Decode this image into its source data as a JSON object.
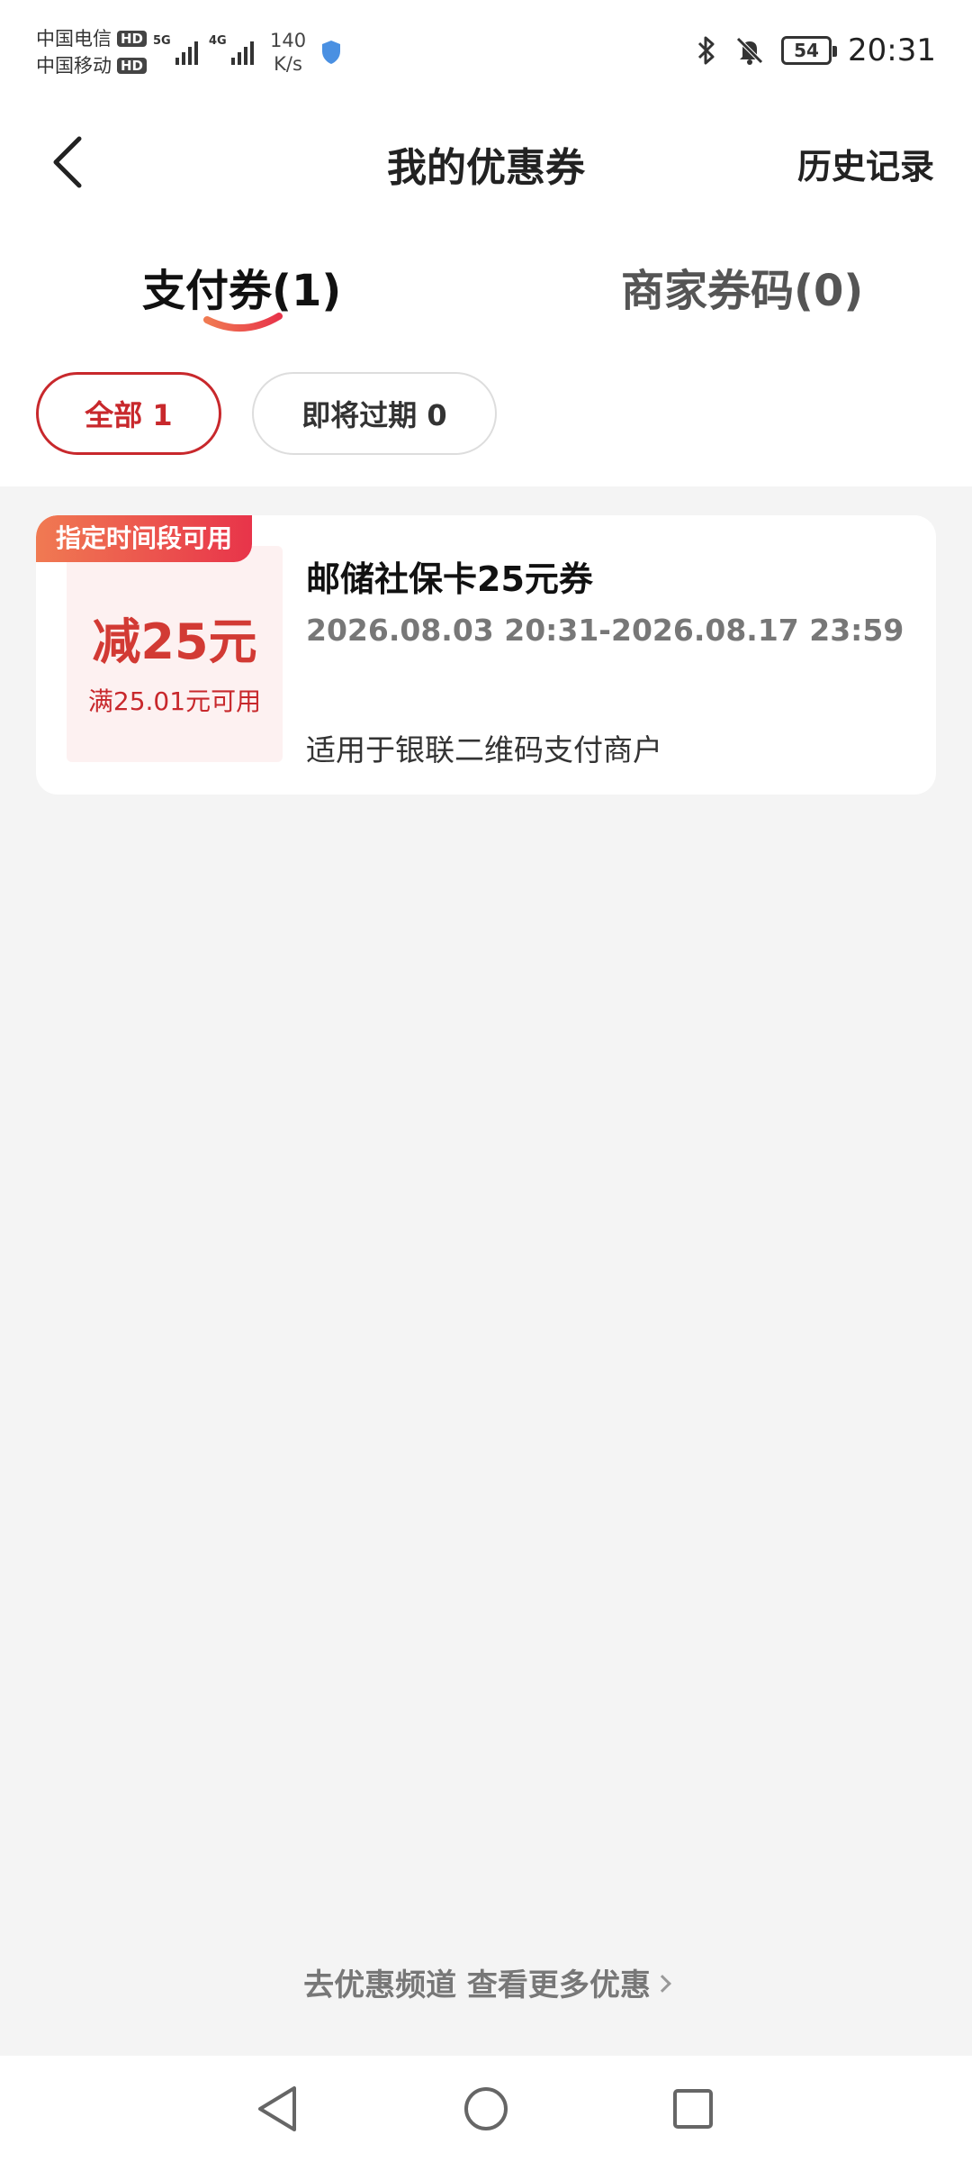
{
  "status_bar": {
    "carrier1": "中国电信",
    "carrier2": "中国移动",
    "hd_badge": "HD",
    "signal1_gen": "5G",
    "signal2_gen": "4G",
    "net_speed_value": "140",
    "net_speed_unit": "K/s",
    "battery": "54",
    "time": "20:31",
    "icons": [
      "bluetooth-icon",
      "bell-muted-icon",
      "battery-icon",
      "shield-icon"
    ]
  },
  "header": {
    "title": "我的优惠券",
    "history_label": "历史记录"
  },
  "tabs": [
    {
      "label": "支付券(1)",
      "active": true
    },
    {
      "label": "商家券码(0)",
      "active": false
    }
  ],
  "filters": [
    {
      "label": "全部 1",
      "active": true
    },
    {
      "label": "即将过期 0",
      "active": false
    }
  ],
  "coupons": [
    {
      "tag": "指定时间段可用",
      "amount": "减25元",
      "threshold": "满25.01元可用",
      "name": "邮储社保卡25元券",
      "validity": "2026.08.03 20:31-2026.08.17 23:59",
      "scope": "适用于银联二维码支付商户"
    }
  ],
  "footer": {
    "more_link": "去优惠频道 查看更多优惠"
  },
  "colors": {
    "accent": "#c8282c",
    "tag_gradient_start": "#f07a52",
    "tag_gradient_end": "#e8344a",
    "background": "#f4f4f4"
  }
}
